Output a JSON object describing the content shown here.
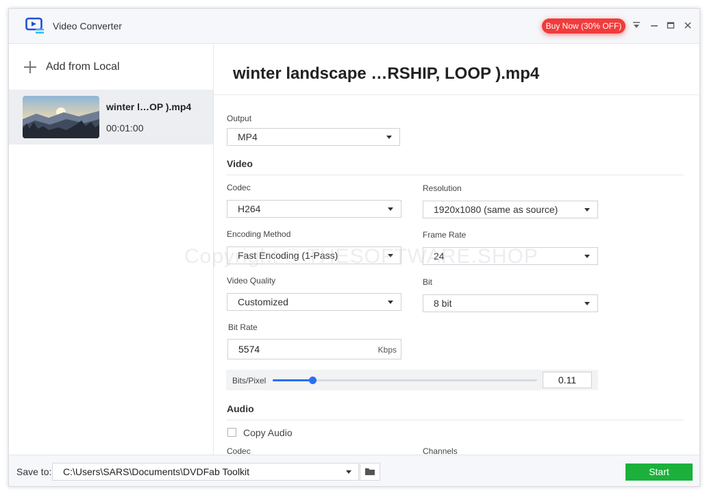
{
  "app": {
    "title": "Video Converter",
    "buy_label": "Buy Now (30% OFF)"
  },
  "sidebar": {
    "add_label": "Add from Local",
    "files": [
      {
        "name": "winter l…OP ).mp4",
        "duration": "00:01:00"
      }
    ]
  },
  "main": {
    "title": "winter landscape …RSHIP, LOOP ).mp4",
    "output": {
      "label": "Output",
      "value": "MP4"
    },
    "video": {
      "heading": "Video",
      "codec": {
        "label": "Codec",
        "value": "H264"
      },
      "resolution": {
        "label": "Resolution",
        "value": "1920x1080 (same as source)"
      },
      "encoding": {
        "label": "Encoding Method",
        "value": "Fast Encoding (1-Pass)"
      },
      "frame_rate": {
        "label": "Frame Rate",
        "value": "24"
      },
      "quality": {
        "label": "Video Quality",
        "value": "Customized"
      },
      "bit": {
        "label": "Bit",
        "value": "8 bit"
      },
      "bit_rate": {
        "label": "Bit Rate",
        "value": "5574",
        "unit": "Kbps"
      },
      "bits_pixel": {
        "label": "Bits/Pixel",
        "value": "0.11",
        "slider_fraction": 0.15
      }
    },
    "audio": {
      "heading": "Audio",
      "copy_label": "Copy Audio",
      "copy_checked": false,
      "codec_label": "Codec",
      "channels_label": "Channels"
    }
  },
  "watermark": "Copyright © THESOFTWARE.SHOP",
  "bottom": {
    "save_label": "Save to:",
    "path": "C:\\Users\\SARS\\Documents\\DVDFab Toolkit",
    "start_label": "Start"
  },
  "colors": {
    "accent": "#2a6ef5",
    "start": "#1bb13b",
    "buy": "#f23b3b"
  }
}
